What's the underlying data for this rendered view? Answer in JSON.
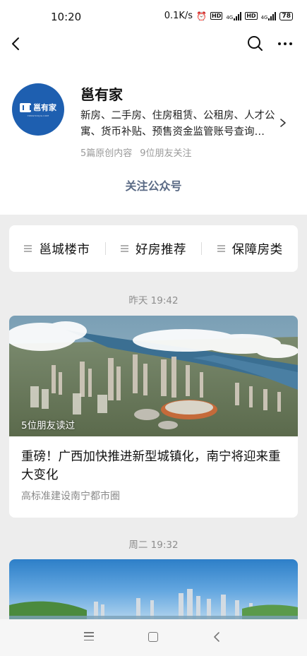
{
  "status_bar": {
    "time": "10:20",
    "network_speed": "0.1K/s",
    "hd_label": "HD",
    "net_label": "4G",
    "battery": "78"
  },
  "nav": {
    "back_icon": "chevron-left-icon",
    "search_icon": "search-icon",
    "more_icon": "more-icon"
  },
  "profile": {
    "avatar_text": "邕有家",
    "avatar_subtext": "YONGYOUJIA.COM",
    "name": "邕有家",
    "description": "新房、二手房、住房租赁、公租房、人才公寓、货币补贴、预售资金监管账号查询…",
    "original_count": "5篇原创内容",
    "friends_follow": "9位朋友关注",
    "follow_label": "关注公众号",
    "brand_color": "#1e5fb0"
  },
  "menu": {
    "items": [
      {
        "label": "邕城楼市"
      },
      {
        "label": "好房推荐"
      },
      {
        "label": "保障房类"
      }
    ]
  },
  "feed": {
    "groups": [
      {
        "time": "昨天 19:42",
        "article": {
          "read_count": "5位朋友读过",
          "title": "重磅！广西加快推进新型城镇化，南宁将迎来重大变化",
          "subtitle": "高标准建设南宁都市圈"
        }
      },
      {
        "time": "周二 19:32"
      }
    ]
  },
  "system_nav": {
    "menu_icon": "menu-icon",
    "home_icon": "home-icon",
    "back_icon": "back-icon"
  }
}
